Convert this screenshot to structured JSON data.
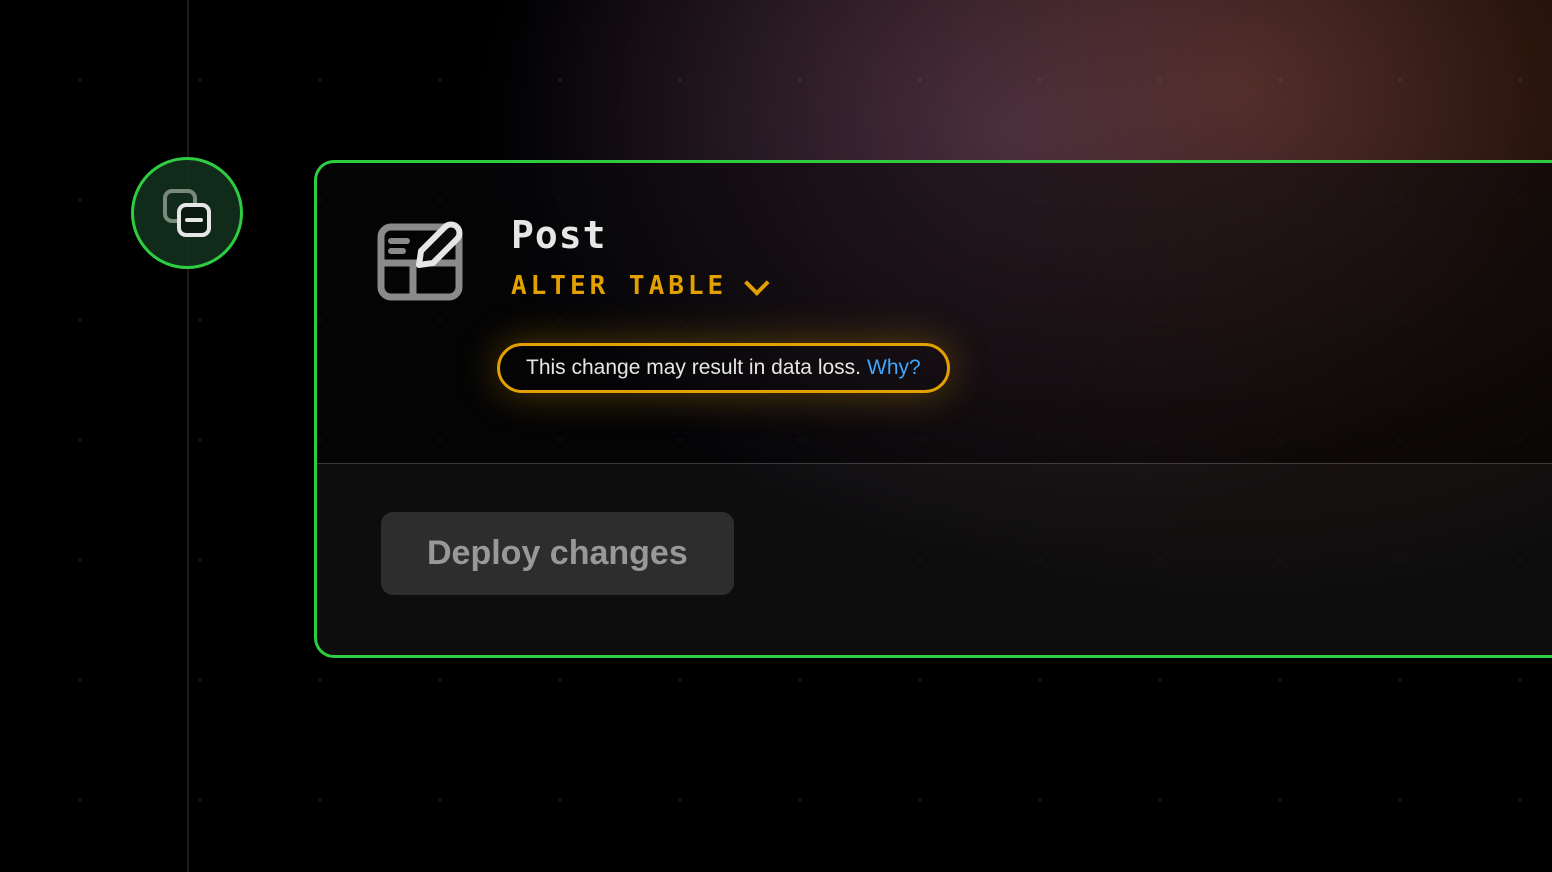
{
  "panel": {
    "entity_name": "Post",
    "action_label": "ALTER TABLE",
    "warning_text": "This change may result in data loss. ",
    "why_link_text": "Why?",
    "deploy_label": "Deploy changes"
  },
  "colors": {
    "accent_green": "#2ecc40",
    "accent_amber": "#e2a100",
    "link_blue": "#3ea6ff"
  }
}
